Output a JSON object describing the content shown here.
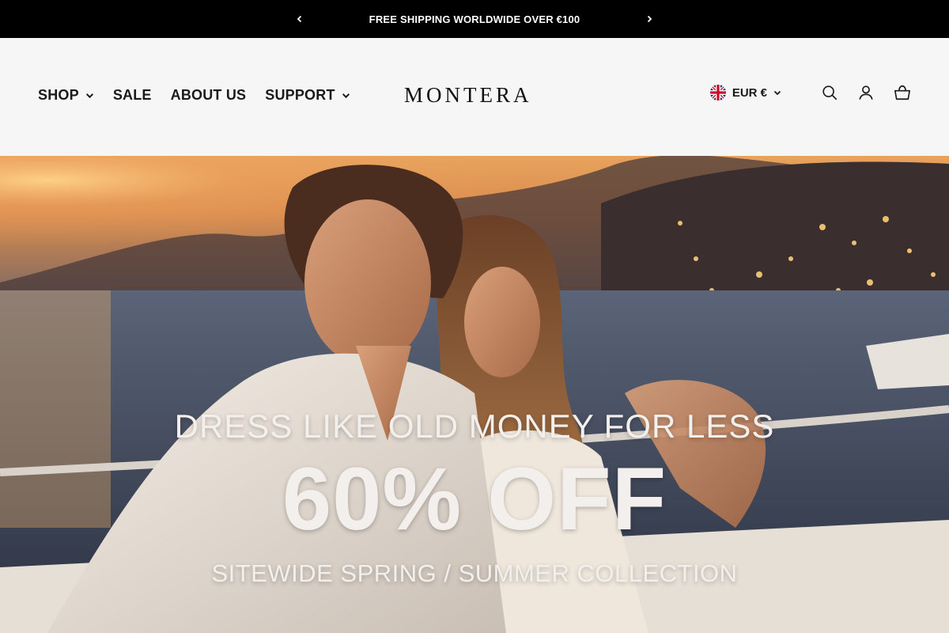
{
  "announcement": {
    "text": "FREE SHIPPING WORLDWIDE OVER €100",
    "prev_icon": "chevron-left-icon",
    "next_icon": "chevron-right-icon"
  },
  "header": {
    "logo": "MONTERA",
    "nav": [
      {
        "label": "SHOP",
        "has_dropdown": true
      },
      {
        "label": "SALE",
        "has_dropdown": false
      },
      {
        "label": "ABOUT US",
        "has_dropdown": false
      },
      {
        "label": "SUPPORT",
        "has_dropdown": true
      }
    ],
    "currency": {
      "label": "EUR €",
      "flag_icon": "uk-flag-icon"
    },
    "icons": [
      "search-icon",
      "account-icon",
      "cart-icon"
    ]
  },
  "hero": {
    "kicker": "DRESS LIKE OLD MONEY FOR LESS",
    "headline": "60% OFF",
    "subtitle": "SITEWIDE SPRING / SUMMER COLLECTION"
  },
  "colors": {
    "announcement_bg": "#000000",
    "header_bg": "#f6f6f6",
    "text_dark": "#1a1a1a",
    "hero_text": "#f3efec"
  }
}
